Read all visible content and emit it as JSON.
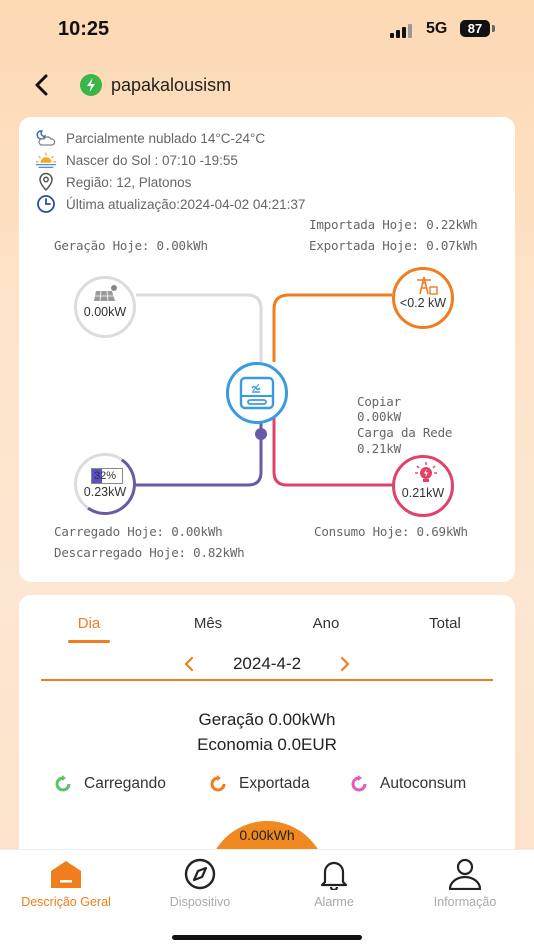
{
  "status": {
    "time": "10:25",
    "network": "5G",
    "battery": "87"
  },
  "header": {
    "station_name": "papakalousism"
  },
  "weather": {
    "condition": "Parcialmente nublado 14°C-24°C",
    "sun": "Nascer do Sol : 07:10 -19:55",
    "region": "Região: 12, Platonos",
    "updated": "Última atualização:2024-04-02 04:21:37"
  },
  "flow": {
    "generation_today": "Geração Hoje: 0.00kWh",
    "imported_today": "Importada Hoje: 0.22kWh",
    "exported_today": "Exportada Hoje: 0.07kWh",
    "solar_power": "0.00kW",
    "grid_power": "<0.2 kW",
    "battery_soc": "32%",
    "battery_power": "0.23kW",
    "load_power": "0.21kW",
    "copy_label": "Copiar",
    "copy_value": "0.00kW",
    "grid_load_label": "Carga da Rede",
    "grid_load_value": "0.21kW",
    "charged_today": "Carregado Hoje: 0.00kWh",
    "discharged_today": "Descarregado Hoje: 0.82kWh",
    "consumption_today": "Consumo Hoje: 0.69kWh",
    "battery_soc_fraction": 0.32
  },
  "stats": {
    "tabs": [
      "Dia",
      "Mês",
      "Ano",
      "Total"
    ],
    "active_tab": "Dia",
    "date": "2024-4-2",
    "generation": "Geração 0.00kWh",
    "savings": "Economia 0.0EUR",
    "legend": [
      {
        "label": "Carregando",
        "color": "#5cc36a"
      },
      {
        "label": "Exportada",
        "color": "#f07d1e"
      },
      {
        "label": "Autoconsum",
        "color": "#e85ab5"
      }
    ],
    "chart_value": "0.00kWh"
  },
  "nav": [
    {
      "label": "Descrição Geral",
      "icon": "home-icon",
      "active": true
    },
    {
      "label": "Dispositivo",
      "icon": "compass-icon",
      "active": false
    },
    {
      "label": "Alarme",
      "icon": "bell-icon",
      "active": false
    },
    {
      "label": "Informação",
      "icon": "user-icon",
      "active": false
    }
  ],
  "colors": {
    "accent": "#f07d1e",
    "grid": "#f07d1e",
    "load": "#e0436a",
    "battery": "#6b58a8",
    "inverter": "#3a9be0"
  }
}
